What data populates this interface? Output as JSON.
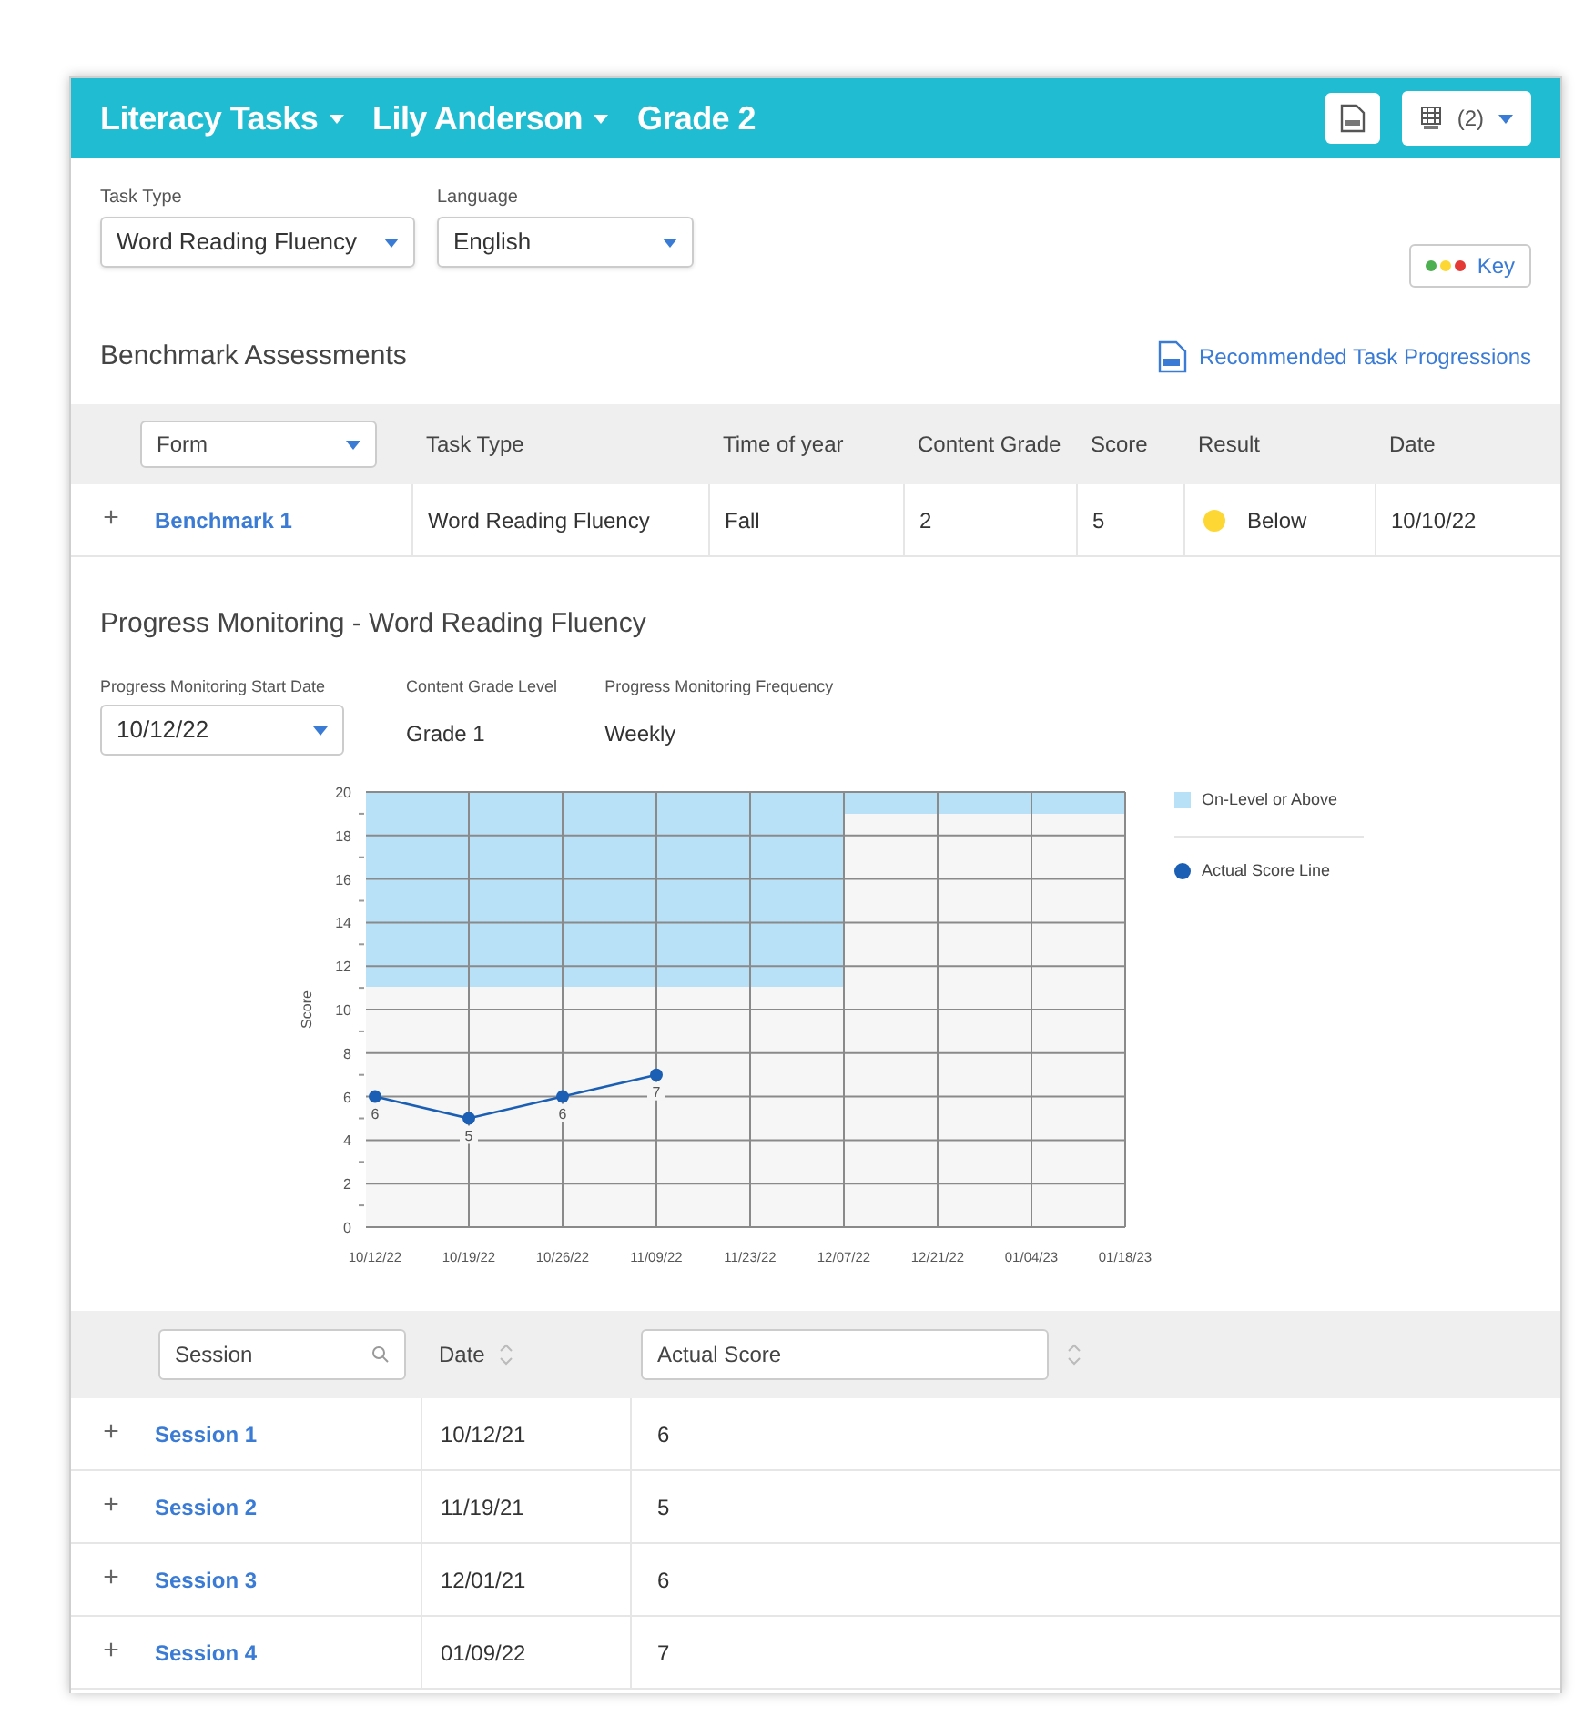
{
  "header": {
    "menus": [
      {
        "label": "Literacy Tasks",
        "dropdown": true
      },
      {
        "label": "Lily Anderson",
        "dropdown": true
      },
      {
        "label": "Grade 2",
        "dropdown": false
      }
    ],
    "export_count": "(2)"
  },
  "filters": [
    {
      "label": "Task Type",
      "value": "Word Reading Fluency"
    },
    {
      "label": "Language",
      "value": "English"
    }
  ],
  "key_button": {
    "label": "Key",
    "dots": [
      {
        "color": "#4caf50"
      },
      {
        "color": "#fdd835"
      },
      {
        "color": "#e53935"
      }
    ]
  },
  "benchmark": {
    "title": "Benchmark Assessments",
    "link": "Recommended Task Progressions",
    "form_filter": "Form",
    "columns": [
      "Task Type",
      "Time of year",
      "Content Grade",
      "Score",
      "Result",
      "Date"
    ],
    "rows": [
      {
        "toggle": "+",
        "form": "Benchmark 1",
        "task_type": "Word Reading Fluency",
        "time_of_year": "Fall",
        "content_grade": "2",
        "score": "5",
        "result": "Below",
        "color": "#fdd835",
        "date": "10/10/22"
      }
    ]
  },
  "progress": {
    "title": "Progress Monitoring - Word Reading Fluency",
    "start_date": {
      "label": "Progress Monitoring Start Date",
      "value": "10/12/22"
    },
    "region_legend": "On-Level or Above",
    "info": [
      {
        "label": "Content Grade Level",
        "value": "Grade 1"
      },
      {
        "label": "Progress Monitoring Frequency",
        "value": "Weekly"
      }
    ],
    "chart_data": {
      "type": "line",
      "ylabel": "Score",
      "grid": true,
      "categories": [
        "10/12/22",
        "10/19/22",
        "10/26/22",
        "11/09/22",
        "11/23/22",
        "12/07/22",
        "12/21/22",
        "01/04/23",
        "01/18/23"
      ],
      "ylim": [
        0,
        20
      ],
      "yticks": [
        0,
        2,
        4,
        6,
        8,
        10,
        12,
        14,
        16,
        18,
        20
      ],
      "data_labels": true,
      "series": [
        {
          "name": "Actual Score Line",
          "color": "#1a5fb4",
          "marker": "circle",
          "values": [
            6,
            5,
            6,
            7,
            null,
            null,
            null,
            null,
            null
          ]
        }
      ]
    }
  },
  "sessions": {
    "search_placeholder": "Session",
    "date_column": "Date",
    "score_placeholder": "Actual Score",
    "rows": [
      {
        "toggle": "+",
        "session": "Session 1",
        "date": "10/12/21",
        "score": "6"
      },
      {
        "toggle": "+",
        "session": "Session 2",
        "date": "11/19/21",
        "score": "5"
      },
      {
        "toggle": "+",
        "session": "Session 3",
        "date": "12/01/21",
        "score": "6"
      },
      {
        "toggle": "+",
        "session": "Session 4",
        "date": "01/09/22",
        "score": "7"
      }
    ]
  }
}
